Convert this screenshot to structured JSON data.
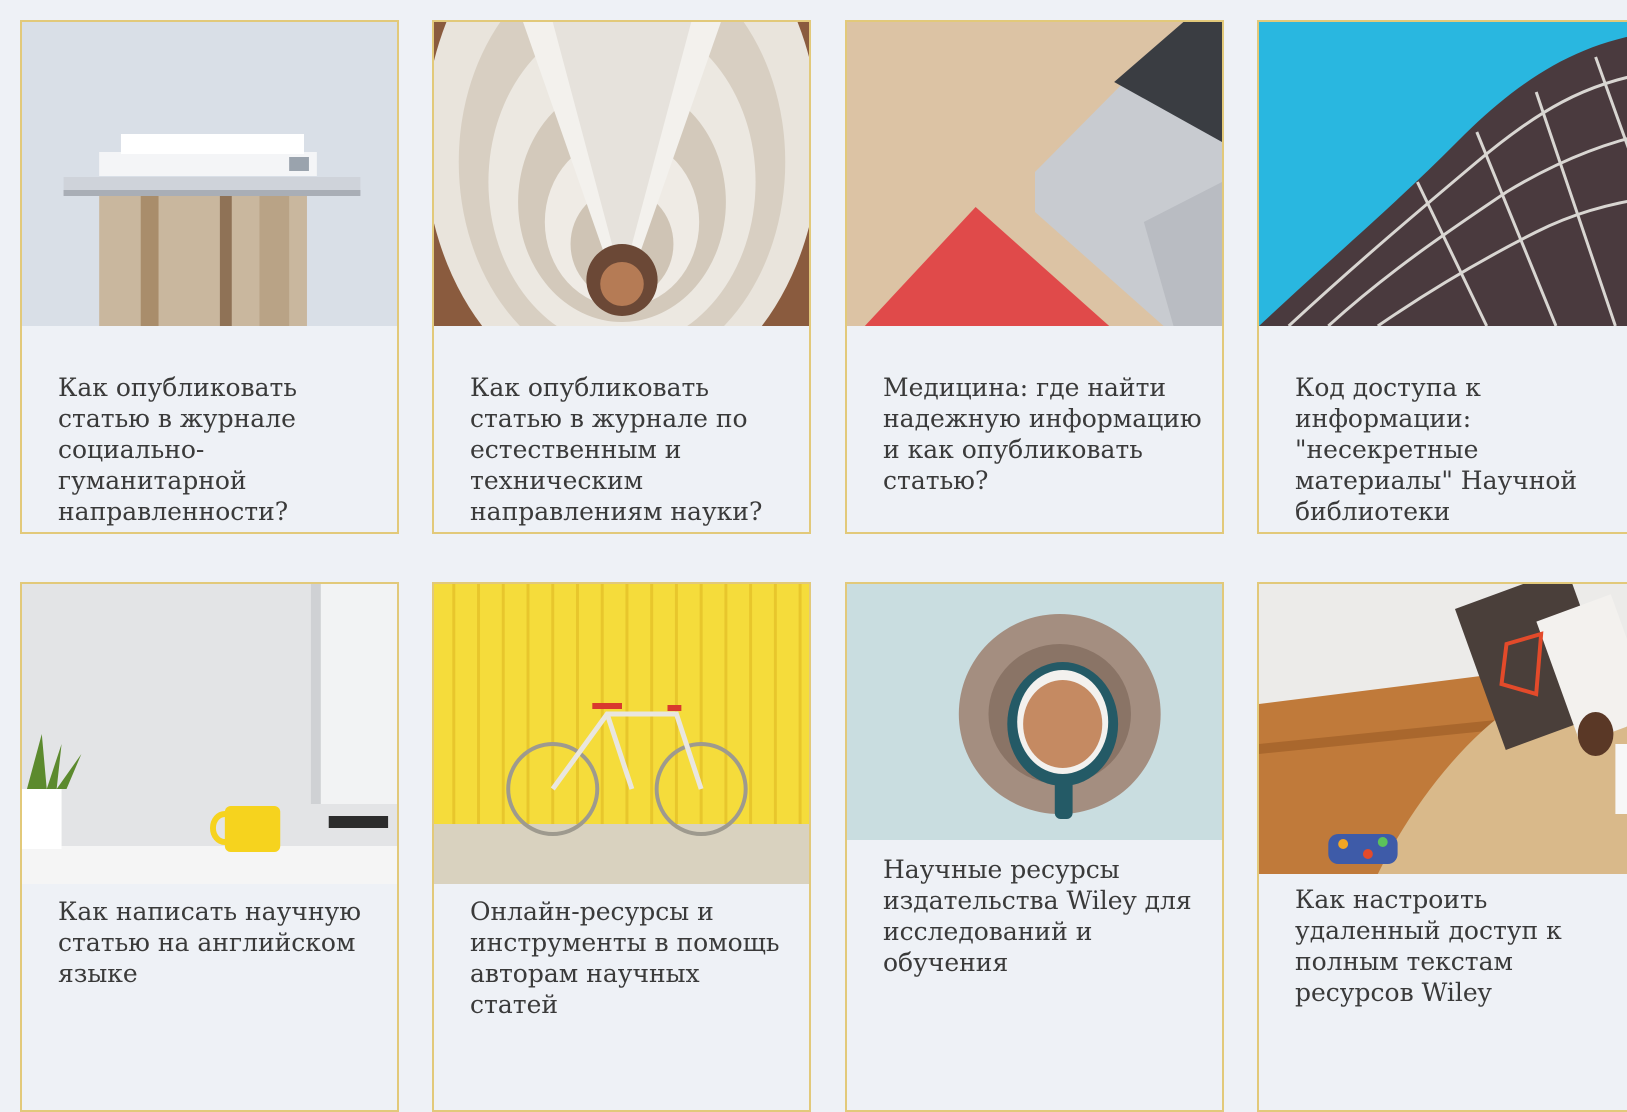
{
  "cards": [
    {
      "title": "Как опубликовать статью в журнале социально-гуманитарной направленности?",
      "image": "books-on-pedestal"
    },
    {
      "title": "Как опубликовать статью в журнале по естественным и техническим направлениям науки?",
      "image": "atrium-spiral"
    },
    {
      "title": "Медицина: где найти надежную информацию и как опубликовать статью?",
      "image": "laptop-on-desk"
    },
    {
      "title": "Код доступа к информации: \"несекретные материалы\" Научной библиотеки",
      "image": "curved-architecture"
    },
    {
      "title": "Как написать научную статью на английском языке",
      "image": "desk-with-monitor"
    },
    {
      "title": "Онлайн-ресурсы и инструменты в помощь авторам научных статей",
      "image": "bicycle-yellow-wall"
    },
    {
      "title": "Научные ресурсы издательства Wiley для исследований и обучения",
      "image": "coffee-cup"
    },
    {
      "title": "Как настроить удаленный доступ к полным текстам ресурсов Wiley",
      "image": "person-reading-book"
    }
  ],
  "colors": {
    "background": "#eef1f6",
    "card_border": "#e2c97a",
    "text": "#3a3a3a"
  }
}
